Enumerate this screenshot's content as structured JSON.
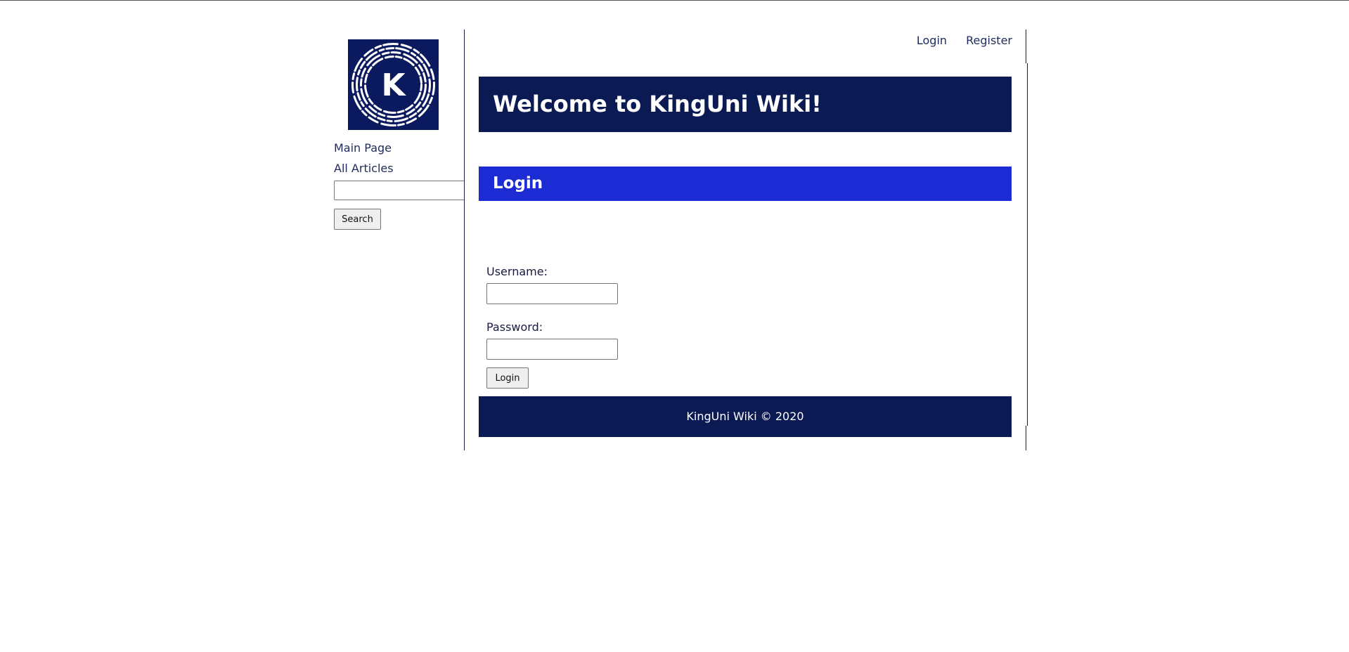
{
  "sidebar": {
    "logo_letter": "K",
    "nav": {
      "main_page": "Main Page",
      "all_articles": "All Articles"
    },
    "search": {
      "value": "",
      "button_label": "Search"
    }
  },
  "header": {
    "login_link": "Login",
    "register_link": "Register",
    "welcome_title": "Welcome to KingUni Wiki!"
  },
  "login_section": {
    "title": "Login",
    "username_label": "Username:",
    "username_value": "",
    "password_label": "Password:",
    "password_value": "",
    "submit_label": "Login"
  },
  "footer": {
    "text": "KingUni Wiki © 2020"
  },
  "colors": {
    "navy": "#0b1a52",
    "royal_blue": "#1c2bd4",
    "text": "#1f2a5a"
  }
}
